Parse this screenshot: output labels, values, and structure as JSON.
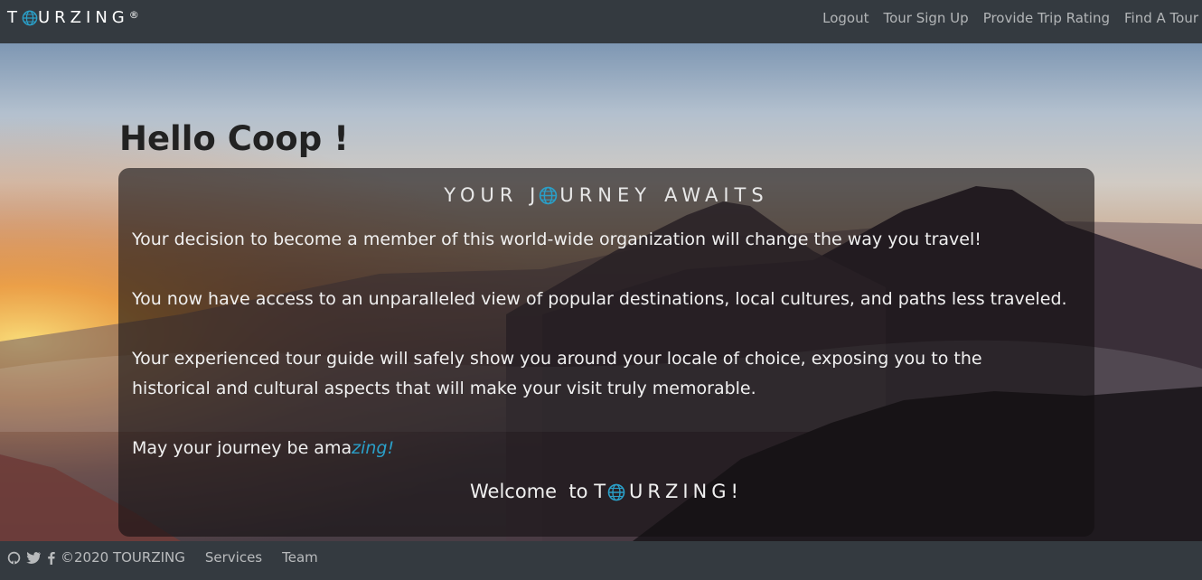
{
  "navbar": {
    "brand_prefix": "T",
    "brand_suffix": "URZING",
    "brand_mark": "®",
    "links": [
      "Logout",
      "Tour Sign Up",
      "Provide Trip Rating",
      "Find A Tour"
    ]
  },
  "hero": {
    "greeting": "Hello Coop !"
  },
  "card": {
    "title_prefix": "YOUR J",
    "title_suffix": "URNEY",
    "title_end": "AWAITS",
    "paragraphs": [
      "Your decision to become a member of this world-wide organization will change the way you travel!",
      "You now have access to an unparalleled view of popular destinations, local cultures, and paths less traveled.",
      "Your experienced tour guide will safely show you around your locale of choice, exposing you to the",
      "historical and cultural aspects that will make your visit truly memorable."
    ],
    "closing_plain": "May your journey be ama",
    "closing_accent": "zing!",
    "welcome_text": "Welcome  to ",
    "welcome_brand_prefix": "T",
    "welcome_brand_suffix": "URZING!"
  },
  "footer": {
    "icons": [
      "github-icon",
      "twitter-icon",
      "facebook-icon"
    ],
    "copyright": "©2020 TOURZING",
    "links": [
      "Services",
      "Team"
    ]
  },
  "colors": {
    "navbar_bg": "#343a40",
    "accent": "#2a9fc8",
    "card_bg": "rgba(20,16,18,0.62)"
  }
}
